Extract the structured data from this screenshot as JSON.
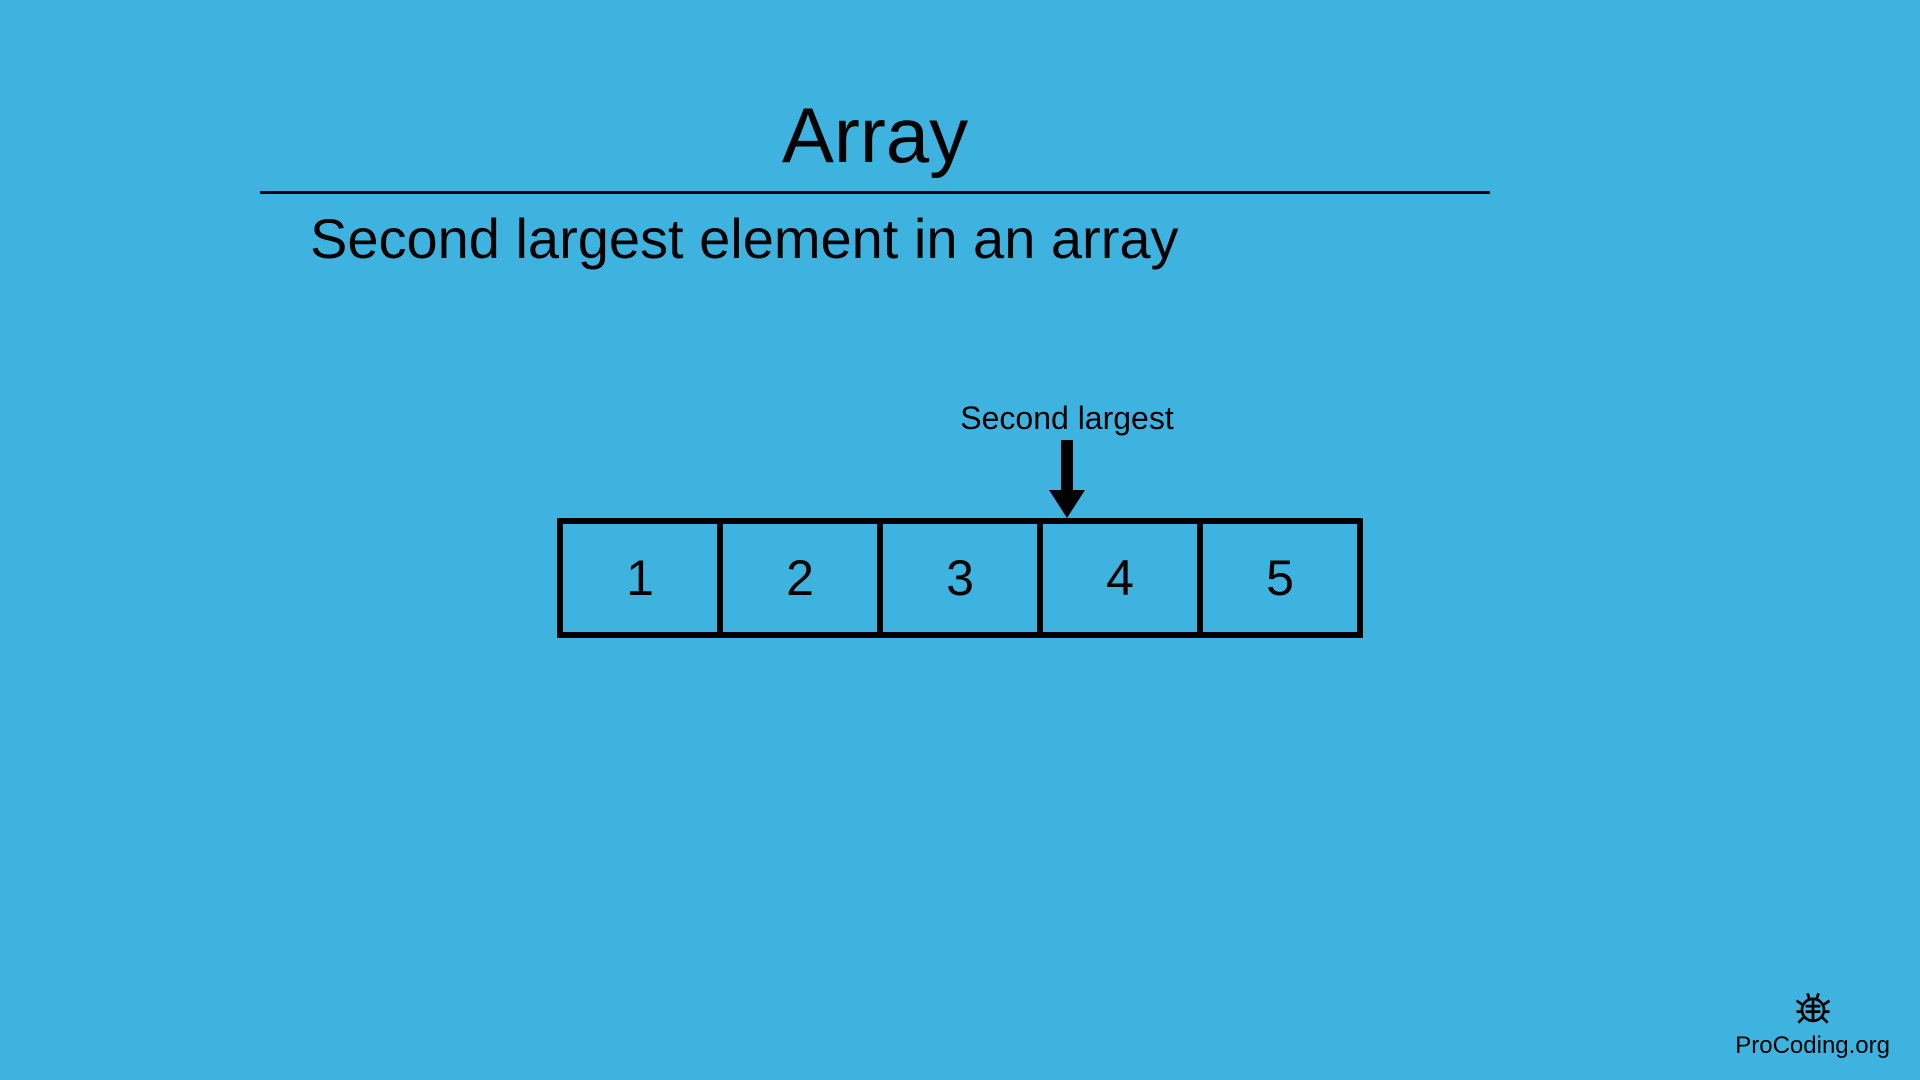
{
  "header": {
    "title": "Array",
    "subtitle": "Second largest element in an array"
  },
  "diagram": {
    "pointer_label": "Second largest",
    "cells": [
      "1",
      "2",
      "3",
      "4",
      "5"
    ],
    "pointer_index": 3
  },
  "footer": {
    "site": "ProCoding.org"
  }
}
